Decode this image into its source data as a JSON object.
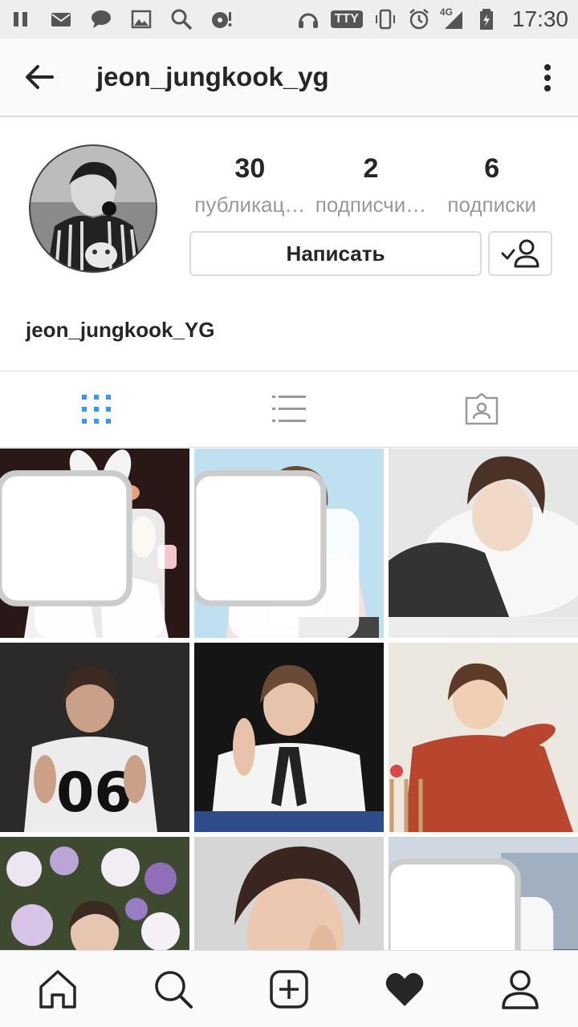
{
  "status_bar": {
    "time": "17:30",
    "tty_label": "TTY",
    "network_label": "4G",
    "icons_left": [
      "pause-icon",
      "mail-icon",
      "chat-icon",
      "image-icon",
      "search-icon",
      "disc-icon"
    ],
    "icons_right": [
      "headset-icon",
      "tty-icon",
      "vibrate-icon",
      "alarm-icon",
      "signal-icon",
      "battery-icon"
    ]
  },
  "header": {
    "username": "jeon_jungkook_yg"
  },
  "profile": {
    "posts_count": "30",
    "posts_label": "публикац…",
    "followers_count": "2",
    "followers_label": "подписчи…",
    "following_count": "6",
    "following_label": "подписки",
    "message_button": "Написать",
    "display_name": "jeon_jungkook_YG"
  },
  "tabs": [
    {
      "name": "grid",
      "active": true
    },
    {
      "name": "list",
      "active": false
    },
    {
      "name": "tagged",
      "active": false
    }
  ],
  "grid_posts": [
    {
      "id": 1,
      "multiple": true
    },
    {
      "id": 2,
      "multiple": true
    },
    {
      "id": 3,
      "multiple": false
    },
    {
      "id": 4,
      "multiple": false
    },
    {
      "id": 5,
      "multiple": false
    },
    {
      "id": 6,
      "multiple": false
    },
    {
      "id": 7,
      "multiple": false
    },
    {
      "id": 8,
      "multiple": false
    },
    {
      "id": 9,
      "multiple": true
    }
  ],
  "bottom_nav": [
    "home-icon",
    "search-icon",
    "new-post-icon",
    "activity-heart-icon",
    "profile-icon"
  ],
  "colors": {
    "accent_blue": "#3897f0",
    "text_dark": "#262626",
    "text_gray": "#999999",
    "border": "#dbdbdb"
  }
}
